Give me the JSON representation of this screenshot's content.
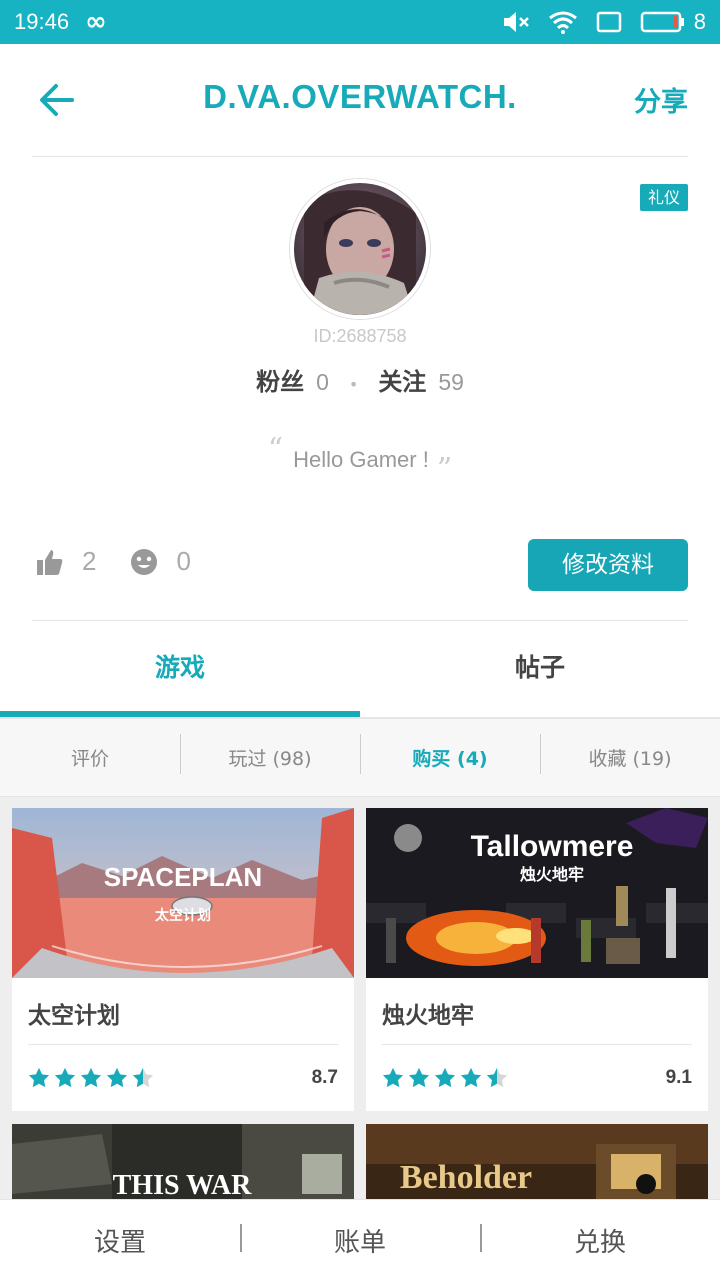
{
  "status_bar": {
    "time": "19:46",
    "battery_level": "8",
    "accent_color": "#17b3c2"
  },
  "header": {
    "title": "D.VA.OVERWATCH.",
    "share_label": "分享",
    "back_icon": "arrow-left-icon"
  },
  "profile": {
    "badge": "礼仪",
    "user_id": "ID:2688758",
    "fans_label": "粉丝",
    "fans_count": "0",
    "follow_label": "关注",
    "follow_count": "59",
    "motto": "Hello Gamer !",
    "likes_count": "2",
    "face_count": "0",
    "edit_button": "修改资料"
  },
  "tabs": [
    {
      "label": "游戏",
      "active": true
    },
    {
      "label": "帖子",
      "active": false
    }
  ],
  "subtabs": [
    {
      "label": "评价",
      "active": false
    },
    {
      "label": "玩过 (98)",
      "active": false
    },
    {
      "label": "购买 (4)",
      "active": true
    },
    {
      "label": "收藏 (19)",
      "active": false
    }
  ],
  "games": [
    {
      "name": "太空计划",
      "cover_title": "SPACEPLAN",
      "cover_subtitle": "太空计划",
      "stars": 4.5,
      "score": "8.7"
    },
    {
      "name": "烛火地牢",
      "cover_title": "Tallowmere",
      "cover_subtitle": "烛火地牢",
      "stars": 4.5,
      "score": "9.1"
    },
    {
      "name": "",
      "cover_title": "THIS WAR",
      "cover_subtitle": "",
      "stars": null,
      "score": ""
    },
    {
      "name": "",
      "cover_title": "Beholder",
      "cover_subtitle": "",
      "stars": null,
      "score": ""
    }
  ],
  "bottom_bar": {
    "settings": "设置",
    "bills": "账单",
    "redeem": "兑换"
  },
  "colors": {
    "accent": "#17aab9",
    "star": "#17aab9"
  }
}
